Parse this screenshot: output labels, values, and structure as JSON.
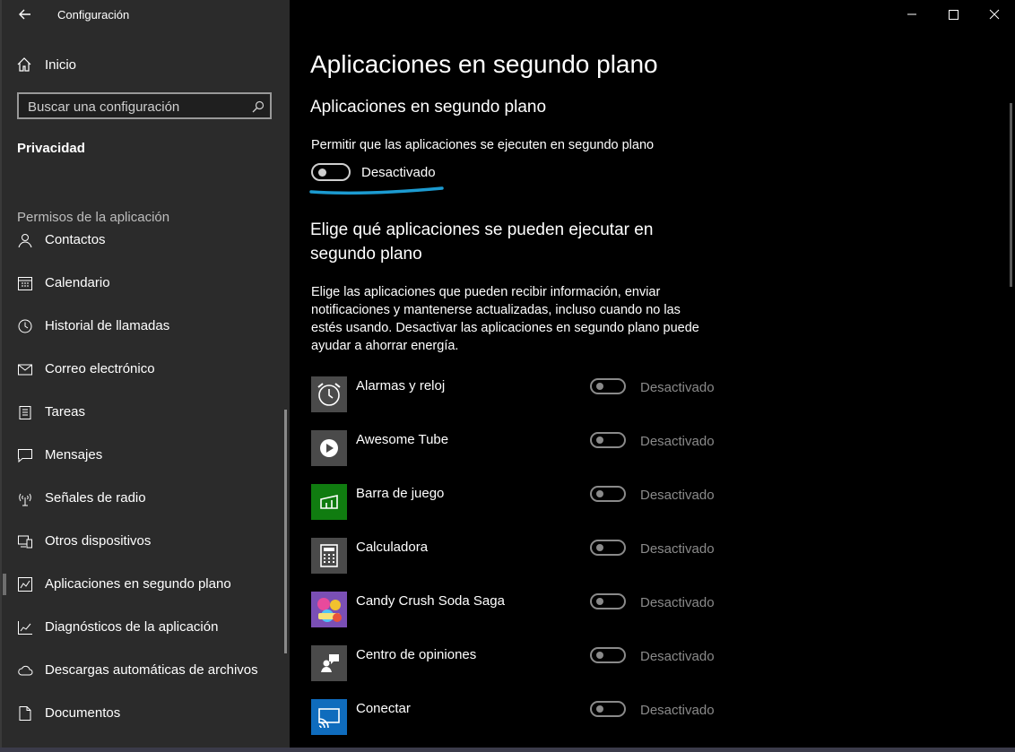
{
  "window": {
    "title": "Configuración",
    "controls": [
      "minimize",
      "maximize",
      "close"
    ]
  },
  "sidebar": {
    "home_label": "Inicio",
    "search_placeholder": "Buscar una configuración",
    "section_title": "Privacidad",
    "group_title": "Permisos de la aplicación",
    "items": [
      {
        "label": "Contactos",
        "icon": "contacts-icon"
      },
      {
        "label": "Calendario",
        "icon": "calendar-icon"
      },
      {
        "label": "Historial de llamadas",
        "icon": "history-icon"
      },
      {
        "label": "Correo electrónico",
        "icon": "mail-icon"
      },
      {
        "label": "Tareas",
        "icon": "tasks-icon"
      },
      {
        "label": "Mensajes",
        "icon": "message-icon"
      },
      {
        "label": "Señales de radio",
        "icon": "radio-icon"
      },
      {
        "label": "Otros dispositivos",
        "icon": "devices-icon"
      },
      {
        "label": "Aplicaciones en segundo plano",
        "icon": "background-apps-icon",
        "active": true
      },
      {
        "label": "Diagnósticos de la aplicación",
        "icon": "diagnostics-icon"
      },
      {
        "label": "Descargas automáticas de archivos",
        "icon": "cloud-icon"
      },
      {
        "label": "Documentos",
        "icon": "document-icon"
      }
    ]
  },
  "main": {
    "page_title": "Aplicaciones en segundo plano",
    "section_title": "Aplicaciones en segundo plano",
    "permission_label": "Permitir que las aplicaciones se ejecuten en segundo plano",
    "permission_state": "Desactivado",
    "choose_title": "Elige qué aplicaciones se pueden ejecutar en segundo plano",
    "choose_description": "Elige las aplicaciones que pueden recibir información, enviar notificaciones y mantenerse actualizadas, incluso cuando no las estés usando. Desactivar las aplicaciones en segundo plano puede ayudar a ahorrar energía.",
    "apps": [
      {
        "name": "Alarmas y reloj",
        "state": "Desactivado",
        "icon": "alarm-clock-icon",
        "color": "#4a4a4a"
      },
      {
        "name": "Awesome Tube",
        "state": "Desactivado",
        "icon": "play-icon",
        "color": "#4a4a4a"
      },
      {
        "name": "Barra de juego",
        "state": "Desactivado",
        "icon": "game-bar-icon",
        "color": "#107c10"
      },
      {
        "name": "Calculadora",
        "state": "Desactivado",
        "icon": "calculator-icon",
        "color": "#4a4a4a"
      },
      {
        "name": "Candy Crush Soda Saga",
        "state": "Desactivado",
        "icon": "candy-crush-icon",
        "color": "#7a4fb5"
      },
      {
        "name": "Centro de opiniones",
        "state": "Desactivado",
        "icon": "feedback-icon",
        "color": "#4a4a4a"
      },
      {
        "name": "Conectar",
        "state": "Desactivado",
        "icon": "connect-icon",
        "color": "#0f6cbd"
      }
    ]
  }
}
